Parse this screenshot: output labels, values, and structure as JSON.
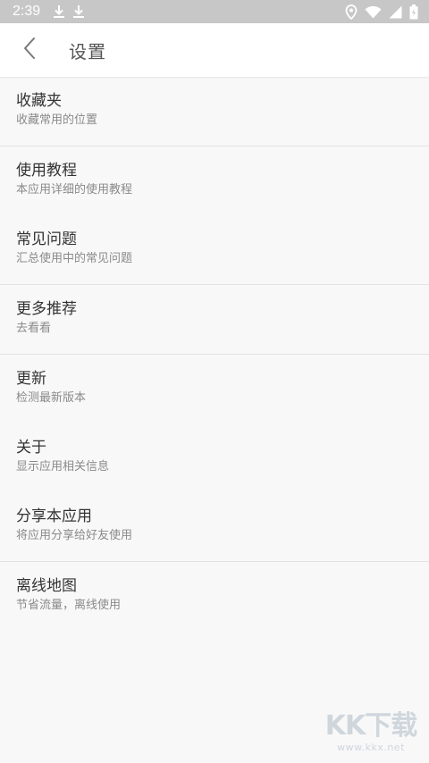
{
  "status_bar": {
    "time": "2:39",
    "icons": [
      "download-icon",
      "download-icon",
      "location-icon",
      "wifi-icon",
      "signal-icon",
      "battery-icon"
    ]
  },
  "app_bar": {
    "back_icon": "chevron-left-icon",
    "title": "设置"
  },
  "groups": [
    [
      {
        "id": "favorites",
        "title": "收藏夹",
        "subtitle": "收藏常用的位置"
      }
    ],
    [
      {
        "id": "tutorial",
        "title": "使用教程",
        "subtitle": "本应用详细的使用教程"
      },
      {
        "id": "faq",
        "title": "常见问题",
        "subtitle": "汇总使用中的常见问题"
      }
    ],
    [
      {
        "id": "more-recommendations",
        "title": "更多推荐",
        "subtitle": "去看看"
      }
    ],
    [
      {
        "id": "update",
        "title": "更新",
        "subtitle": "检测最新版本"
      },
      {
        "id": "about",
        "title": "关于",
        "subtitle": "显示应用相关信息"
      },
      {
        "id": "share",
        "title": "分享本应用",
        "subtitle": "将应用分享给好友使用"
      }
    ],
    [
      {
        "id": "offline-map",
        "title": "离线地图",
        "subtitle": "节省流量，离线使用"
      }
    ]
  ],
  "watermark": {
    "logo": "KK下载",
    "url": "www.kkx.net"
  },
  "colors": {
    "background": "#f8f8f9",
    "status_bar": "#c7c7c7",
    "app_bar": "#ffffff",
    "title_text": "#333333",
    "subtitle_text": "#8a8a8a",
    "divider": "#e2e2e2"
  }
}
